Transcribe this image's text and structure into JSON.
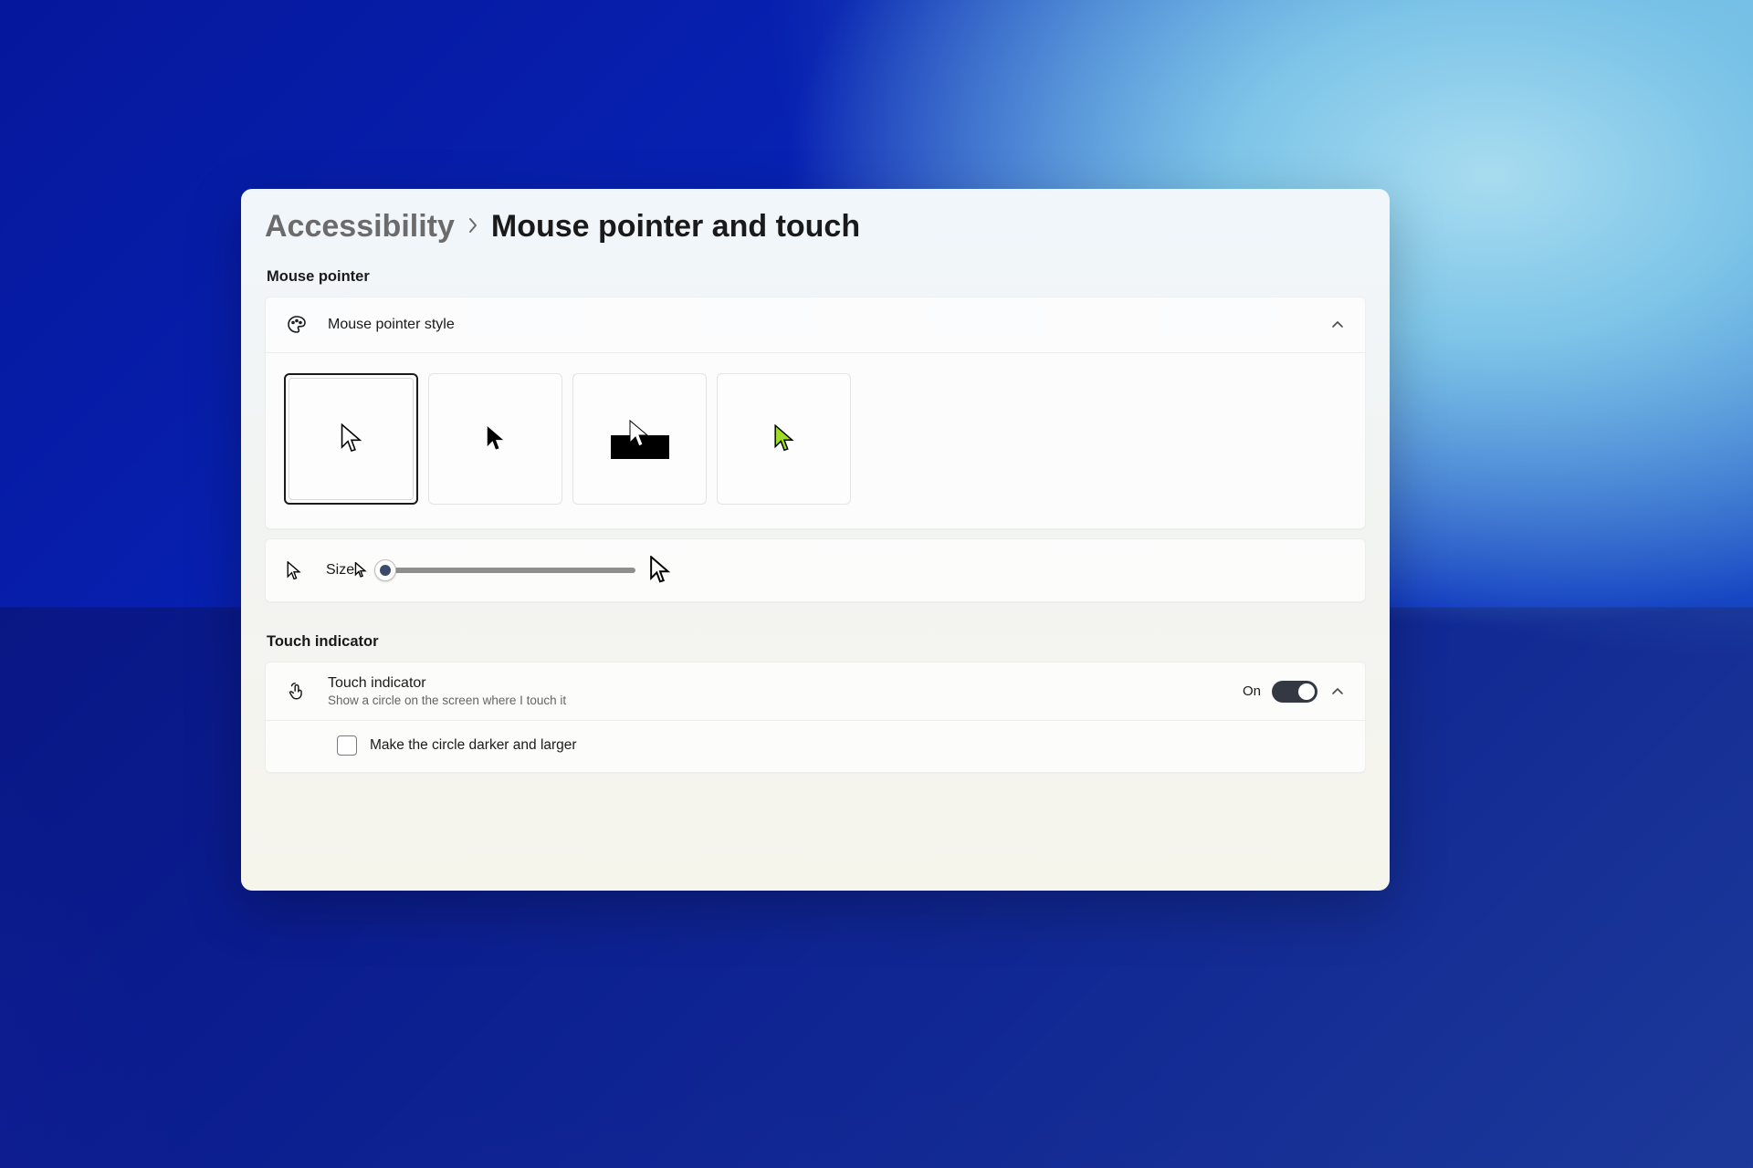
{
  "breadcrumb": {
    "parent": "Accessibility",
    "current": "Mouse pointer and touch"
  },
  "sections": {
    "mouse_pointer": {
      "heading": "Mouse pointer",
      "style_row_label": "Mouse pointer style",
      "styles": [
        {
          "id": "white",
          "selected": true
        },
        {
          "id": "black",
          "selected": false
        },
        {
          "id": "inverted",
          "selected": false
        },
        {
          "id": "custom",
          "selected": false,
          "color": "#9EDB2B"
        }
      ],
      "size_label": "Size",
      "size_value_percent": 2
    },
    "touch_indicator": {
      "heading": "Touch indicator",
      "title": "Touch indicator",
      "subtitle": "Show a circle on the screen where I touch it",
      "toggle_state_label": "On",
      "toggle_on": true,
      "checkbox_label": "Make the circle darker and larger",
      "checkbox_checked": false
    }
  }
}
